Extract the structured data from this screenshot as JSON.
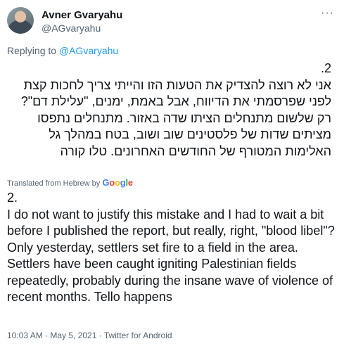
{
  "tweet": {
    "display_name": "Avner Gvaryahu",
    "handle": "@AGvaryahu",
    "more_icon": "···",
    "replying_prefix": "Replying to ",
    "replying_handle": "@AGvaryahu",
    "hebrew_text": "2.\nאני לא רוצה להצדיק את הטעות הזו והייתי צריך לחכות קצת לפני שפרסמתי את הדיווח, אבל באמת, ימנים, \"עלילת דם\"? רק שלשום מתנחלים הציתו שדה באזור. מתנחלים נתפסו מציתים שדות של פלסטינים שוב ושוב, בטח במהלך גל האלימות המטורף של החודשים האחרונים. טלו קורה",
    "translated_label": "Translated from Hebrew by",
    "google_letters": [
      "G",
      "o",
      "o",
      "g",
      "l",
      "e"
    ],
    "english_text": "2.\n I do not want to justify this mistake and I had to wait a bit before I published the report, but really, right, \"blood libel\"? Only yesterday, settlers set fire to a field in the area. Settlers have been caught igniting Palestinian fields repeatedly, probably during the insane wave of violence of recent months. Tello happens",
    "timestamp": "10:03 AM · May 5, 2021 · Twitter for Android"
  }
}
